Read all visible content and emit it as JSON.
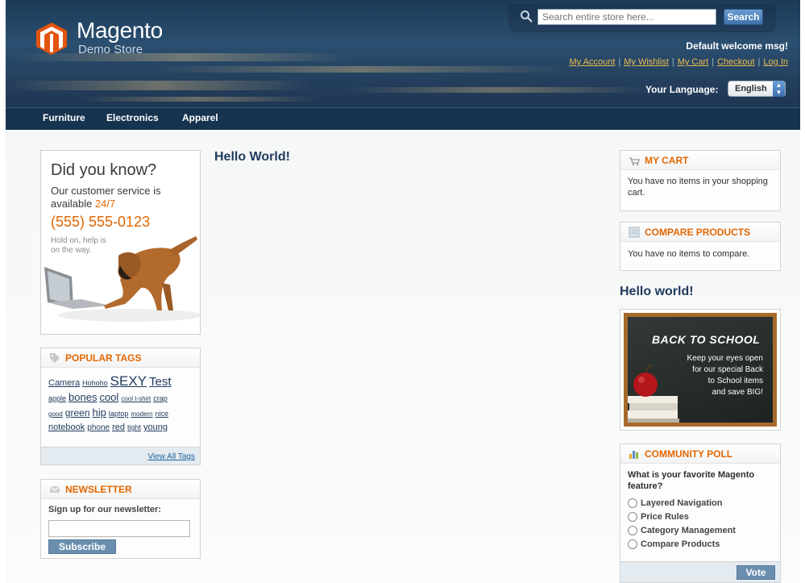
{
  "header": {
    "logo_name": "Magento",
    "logo_sub": "Demo Store",
    "search_placeholder": "Search entire store here...",
    "search_button": "Search",
    "welcome": "Default welcome msg!",
    "links": [
      "My Account",
      "My Wishlist",
      "My Cart",
      "Checkout",
      "Log In"
    ],
    "language_label": "Your Language:",
    "language_value": "English"
  },
  "nav": [
    "Furniture",
    "Electronics",
    "Apparel"
  ],
  "callout": {
    "title": "Did you know?",
    "line1": "Our customer service is",
    "line2_prefix": "available ",
    "line2_highlight": "24/7",
    "phone": "(555) 555-0123",
    "small1": "Hold on, help is",
    "small2": "on the way."
  },
  "tags": {
    "title": "Popular Tags",
    "items": [
      "Camera",
      "Hohoho",
      "SEXY",
      "Test",
      "apple",
      "bones",
      "cool",
      "cool t-shirt",
      "crap",
      "good",
      "green",
      "hip",
      "laptop",
      "modern",
      "nice",
      "notebook",
      "phone",
      "red",
      "tight",
      "young"
    ],
    "view_all": "View All Tags"
  },
  "newsletter": {
    "title": "Newsletter",
    "label": "Sign up for our newsletter:",
    "button": "Subscribe"
  },
  "main": {
    "title": "Hello World!"
  },
  "cart": {
    "title": "My Cart",
    "text": "You have no items in your shopping cart."
  },
  "compare": {
    "title": "Compare Products",
    "text": "You have no items to compare."
  },
  "side_title": "Hello world!",
  "promo": {
    "title": "BACK TO SCHOOL",
    "line1": "Keep your eyes open",
    "line2": "for our special Back",
    "line3": "to School items",
    "line4": "and save BIG!"
  },
  "poll": {
    "title": "Community Poll",
    "question": "What is your favorite Magento feature?",
    "options": [
      "Layered Navigation",
      "Price Rules",
      "Category Management",
      "Compare Products"
    ],
    "vote": "Vote"
  },
  "colors": {
    "accent": "#e26703",
    "nav": "#16334f",
    "link": "#ebbc4e"
  }
}
